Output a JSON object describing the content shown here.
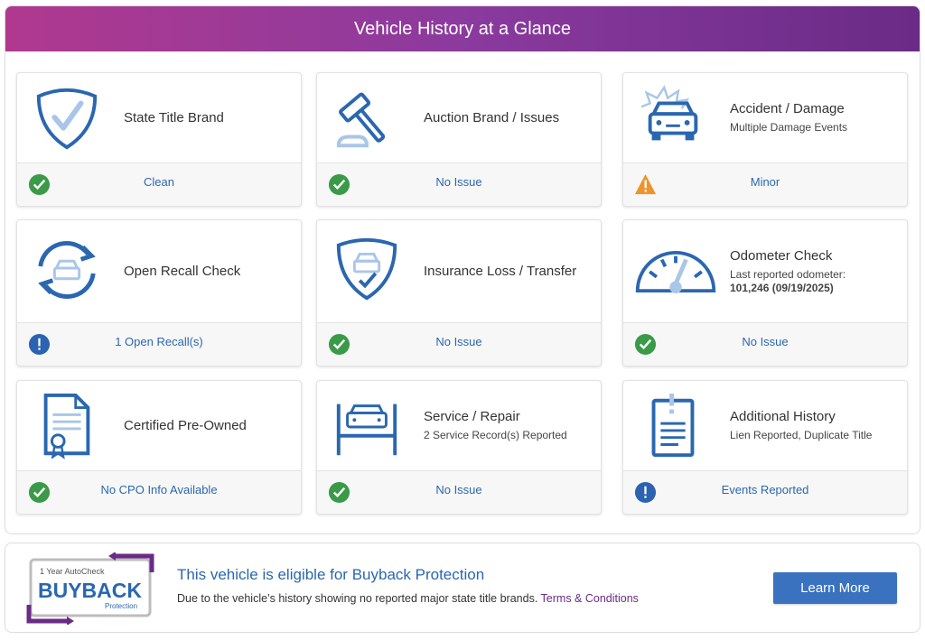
{
  "header": {
    "title": "Vehicle History at a Glance"
  },
  "colors": {
    "brand_purple": "#8b3a9e",
    "accent_blue": "#2a67b0",
    "ok_green": "#3a9a48",
    "warn_orange": "#f0932b",
    "info_blue": "#2c63b0"
  },
  "cards": [
    {
      "title": "State Title Brand",
      "sub": "",
      "status": "Clean",
      "status_icon": "check-icon",
      "icon": "shield-check-icon"
    },
    {
      "title": "Auction Brand / Issues",
      "sub": "",
      "status": "No Issue",
      "status_icon": "check-icon",
      "icon": "gavel-icon"
    },
    {
      "title": "Accident / Damage",
      "sub": "Multiple Damage Events",
      "status": "Minor",
      "status_icon": "warning-icon",
      "icon": "car-crash-icon"
    },
    {
      "title": "Open Recall Check",
      "sub": "",
      "status": "1 Open Recall(s)",
      "status_icon": "alert-icon",
      "icon": "recall-cycle-icon"
    },
    {
      "title": "Insurance Loss / Transfer",
      "sub": "",
      "status": "No Issue",
      "status_icon": "check-icon",
      "icon": "insurance-shield-icon"
    },
    {
      "title": "Odometer Check",
      "sub": "Last reported odometer:",
      "sub_bold": "101,246 (09/19/2025)",
      "status": "No Issue",
      "status_icon": "check-icon",
      "icon": "odometer-icon"
    },
    {
      "title": "Certified Pre-Owned",
      "sub": "",
      "status": "No CPO Info Available",
      "status_icon": "check-icon",
      "icon": "certificate-icon"
    },
    {
      "title": "Service / Repair",
      "sub": "2 Service Record(s) Reported",
      "status": "No Issue",
      "status_icon": "check-icon",
      "icon": "car-lift-icon"
    },
    {
      "title": "Additional History",
      "sub": "Lien Reported, Duplicate Title",
      "status": "Events Reported",
      "status_icon": "alert-icon",
      "icon": "clipboard-alert-icon"
    }
  ],
  "buyback": {
    "logo_top": "1 Year AutoCheck",
    "logo_main": "BUYBACK",
    "logo_bottom": "Protection",
    "title": "This vehicle is eligible for Buyback Protection",
    "desc": "Due to the vehicle’s history showing no reported major state title brands.",
    "terms": "Terms & Conditions",
    "button": "Learn More"
  }
}
